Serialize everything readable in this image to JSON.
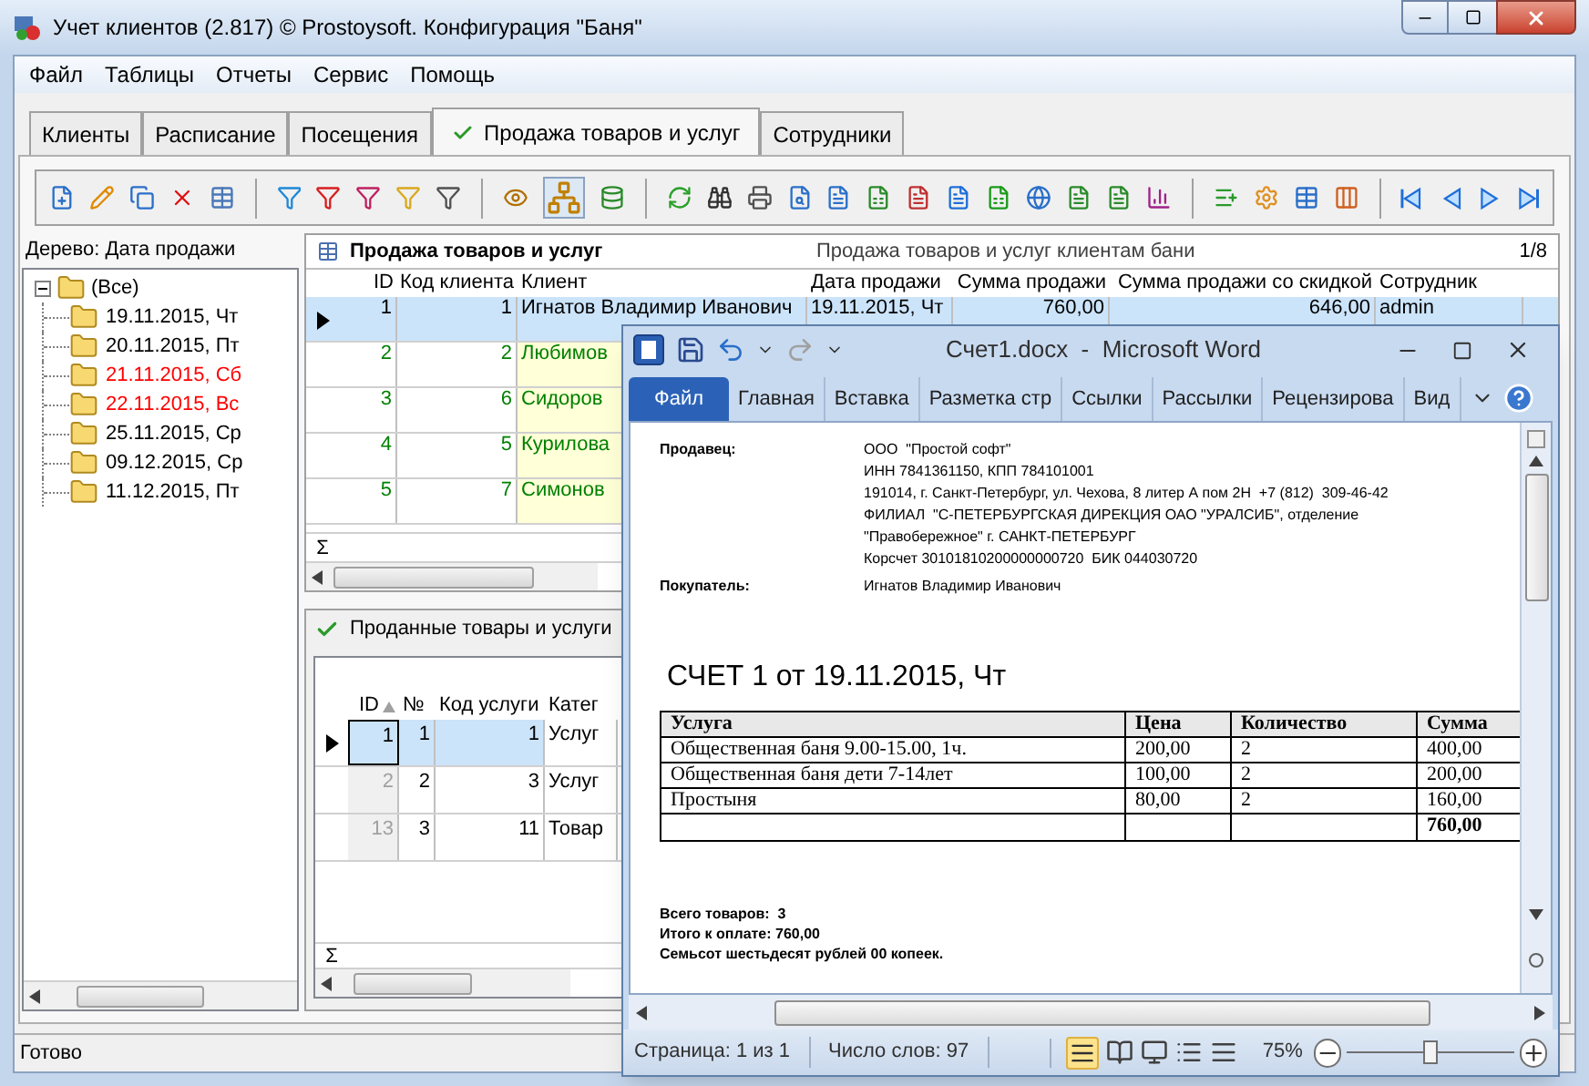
{
  "window": {
    "title": "Учет клиентов (2.817) © Prostoysoft. Конфигурация \"Баня\""
  },
  "menu": [
    "Файл",
    "Таблицы",
    "Отчеты",
    "Сервис",
    "Помощь"
  ],
  "tabs": [
    {
      "label": "Клиенты",
      "selected": false,
      "checked": false
    },
    {
      "label": "Расписание",
      "selected": false,
      "checked": false
    },
    {
      "label": "Посещения",
      "selected": false,
      "checked": false
    },
    {
      "label": "Продажа товаров и услуг",
      "selected": true,
      "checked": true
    },
    {
      "label": "Сотрудники",
      "selected": false,
      "checked": false
    }
  ],
  "toolbar": {
    "tree_view_on": true
  },
  "tree": {
    "label": "Дерево: Дата продажи",
    "items": [
      {
        "label": "(Все)",
        "expanded": true,
        "children": [
          {
            "label": "19.11.2015, Чт",
            "color": "#000000"
          },
          {
            "label": "20.11.2015, Пт",
            "color": "#000000"
          },
          {
            "label": "21.11.2015, Сб",
            "color": "#ff0000"
          },
          {
            "label": "22.11.2015, Вс",
            "color": "#ff0000"
          },
          {
            "label": "25.11.2015, Ср",
            "color": "#000000"
          },
          {
            "label": "09.12.2015, Ср",
            "color": "#000000"
          },
          {
            "label": "11.12.2015, Пт",
            "color": "#000000"
          }
        ]
      }
    ]
  },
  "sales": {
    "title": "Продажа товаров и услуг",
    "subtitle": "Продажа товаров и услуг клиентам бани",
    "counter": "1/8",
    "columns": [
      "ID",
      "Код клиента",
      "Клиент",
      "Дата продажи",
      "Сумма продажи",
      "Сумма продажи со скидкой",
      "Сотрудник"
    ],
    "rows": [
      {
        "selected": true,
        "color": "#000000",
        "cells": [
          "1",
          "1",
          "Игнатов Владимир Иванович",
          "19.11.2015, Чт",
          "760,00",
          "646,00",
          "admin"
        ]
      },
      {
        "selected": false,
        "color": "#008000",
        "cells": [
          "2",
          "2",
          "Любимов"
        ]
      },
      {
        "selected": false,
        "color": "#008000",
        "cells": [
          "3",
          "6",
          "Сидоров"
        ]
      },
      {
        "selected": false,
        "color": "#008000",
        "cells": [
          "4",
          "5",
          "Курилова"
        ]
      },
      {
        "selected": false,
        "color": "#008000",
        "cells": [
          "5",
          "7",
          "Симонов"
        ]
      }
    ],
    "total_marker": "Σ"
  },
  "items": {
    "title": "Проданные товары и услуги",
    "columns": [
      {
        "label": "ID",
        "sorted": true
      },
      {
        "label": "№",
        "sorted": false
      },
      {
        "label": "Код услуги",
        "sorted": false
      },
      {
        "label": "Катег",
        "sorted": false
      }
    ],
    "rows": [
      {
        "selected": true,
        "cells": [
          "1",
          "1",
          "1",
          "Услуг"
        ]
      },
      {
        "selected": false,
        "cells": [
          "2",
          "2",
          "3",
          "Услуг"
        ]
      },
      {
        "selected": false,
        "cells": [
          "13",
          "3",
          "11",
          "Товар"
        ]
      }
    ],
    "total_marker": "Σ"
  },
  "status_bar": {
    "text": "Готово"
  },
  "word": {
    "title": "Счет1.docx  -  Microsoft Word",
    "ribbon_tabs": [
      {
        "label": "Файл",
        "selected": true
      },
      {
        "label": "Главная",
        "selected": false
      },
      {
        "label": "Вставка",
        "selected": false
      },
      {
        "label": "Разметка стр",
        "selected": false
      },
      {
        "label": "Ссылки",
        "selected": false
      },
      {
        "label": "Рассылки",
        "selected": false
      },
      {
        "label": "Рецензирова",
        "selected": false
      },
      {
        "label": "Вид",
        "selected": false
      }
    ],
    "document": {
      "seller_label": "Продавец:",
      "seller_lines": [
        "ООО  \"Простой софт\"",
        "ИНН 7841361150, КПП 784101001",
        "191014, г. Санкт-Петербург, ул. Чехова, 8 литер А пом 2Н  +7 (812)  309-46-42",
        "ФИЛИАЛ  \"С-ПЕТЕРБУРГСКАЯ ДИРЕКЦИЯ ОАО \"УРАЛСИБ\", отделение",
        "\"Правобережное\" г. САНКТ-ПЕТЕРБУРГ",
        "Корсчет 30101810200000000720  БИК 044030720"
      ],
      "buyer_label": "Покупатель:",
      "buyer": "Игнатов Владимир Иванович",
      "heading": "СЧЕТ 1 от 19.11.2015, Чт",
      "table_columns": [
        "Услуга",
        "Цена",
        "Количество",
        "Сумма"
      ],
      "table_rows": [
        [
          "Общественная  баня 9.00-15.00, 1ч.",
          "200,00",
          "2",
          "400,00"
        ],
        [
          "Общественная  баня дети  7-14лет",
          "100,00",
          "2",
          "200,00"
        ],
        [
          "Простыня",
          "80,00",
          "2",
          "160,00"
        ]
      ],
      "table_total": "760,00",
      "summary": [
        "Всего товаров:  3",
        "Итого к оплате: 760,00",
        "Семьсот шестьдесят рублей 00 копеек."
      ]
    },
    "status": {
      "page": "Страница: 1 из 1",
      "words": "Число слов: 97",
      "zoom": "75%",
      "zoom_slider": {
        "level": 0.5
      }
    }
  }
}
